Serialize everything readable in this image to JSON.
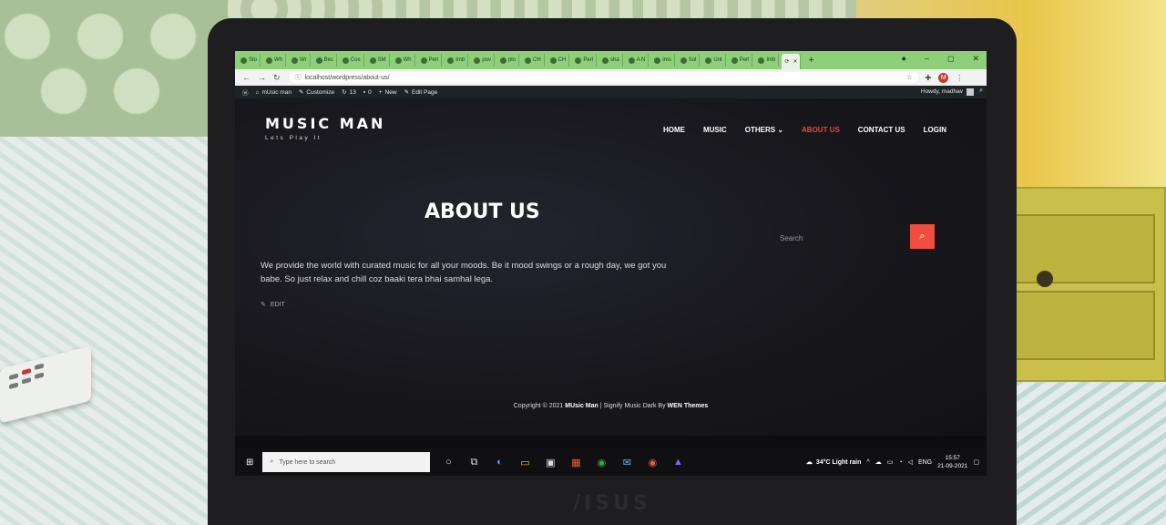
{
  "laptop_brand": "/ISUS",
  "browser": {
    "tabs": [
      "Sto",
      "Wh",
      "Wr",
      "Bec",
      "Cos",
      "SM",
      "Wh",
      "Perl",
      "Imb",
      "pov",
      "plo",
      "CH",
      "CH",
      "Perl",
      "sha",
      "A N",
      "ims",
      "Sol",
      "Unt",
      "Perl",
      "Imb",
      ""
    ],
    "window_controls": [
      "–",
      "◻",
      "✕"
    ],
    "url": "localhost/wordpress/about-us/",
    "profile_initial": "M"
  },
  "wp_admin_bar": {
    "site_name": "mUsic man",
    "customize": "Customize",
    "updates": "13",
    "comments": "0",
    "new": "New",
    "edit_page": "Edit Page",
    "howdy": "Howdy, madhav"
  },
  "site": {
    "logo": "MUSIC MAN",
    "tagline": "Lets Play It",
    "menu": [
      "HOME",
      "MUSIC",
      "OTHERS",
      "ABOUT US",
      "CONTACT US",
      "LOGIN"
    ],
    "page_title": "ABOUT US",
    "content": "We provide the world with curated music for all your moods. Be it mood swings or a rough day, we got you babe. So just relax and chill coz baaki tera bhai samhal lega.",
    "edit_label": "EDIT",
    "search_placeholder": "Search",
    "footer_prefix": "Copyright © 2021",
    "footer_site": "MUsic Man",
    "footer_mid": "| Signify Music Dark By",
    "footer_theme": "WEN Themes"
  },
  "taskbar": {
    "search_placeholder": "Type here to search",
    "weather": "34°C  Light rain",
    "language": "ENG",
    "time": "15:57",
    "date": "21-09-2021"
  },
  "colors": {
    "accent": "#ef4d3f",
    "tabbar": "#8ecf7a",
    "site_bg": "#17171c"
  }
}
